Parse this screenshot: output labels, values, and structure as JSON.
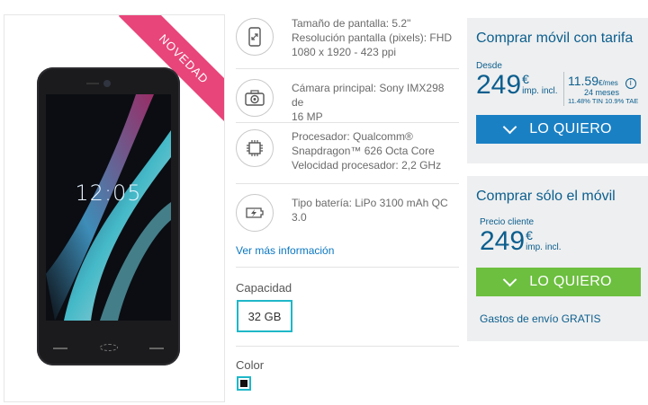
{
  "product": {
    "badge": "NOVEDAD",
    "screen_time": "12:05"
  },
  "specs": [
    {
      "icon": "screen-size-icon",
      "lines": [
        "Tamaño de pantalla: 5.2\"",
        "Resolución pantalla (pixels): FHD",
        "1080 x 1920 - 423 ppi"
      ]
    },
    {
      "icon": "camera-icon",
      "lines": [
        "Cámara principal: Sony IMX298 de",
        "16 MP"
      ]
    },
    {
      "icon": "processor-icon",
      "lines": [
        "Procesador: Qualcomm®",
        "Snapdragon™ 626 Octa Core",
        "Velocidad procesador: 2,2 GHz"
      ]
    },
    {
      "icon": "battery-icon",
      "lines": [
        "Tipo batería: LiPo 3100 mAh QC 3.0"
      ]
    }
  ],
  "more_info": "Ver más información",
  "capacity": {
    "label": "Capacidad",
    "selected": "32 GB"
  },
  "color": {
    "label": "Color",
    "selected_hex": "#111111"
  },
  "tariff_box": {
    "title": "Comprar móvil con tarifa",
    "from": "Desde",
    "price": "249",
    "currency": "€",
    "tax": "imp. incl.",
    "monthly_price": "11.59",
    "monthly_unit": "€/mes",
    "months": "24 meses",
    "rates": "11.48% TIN 10.9% TAE",
    "button": "LO QUIERO"
  },
  "free_box": {
    "title": "Comprar sólo el móvil",
    "price_label": "Precio cliente",
    "price": "249",
    "currency": "€",
    "tax": "imp. incl.",
    "button": "LO QUIERO"
  },
  "shipping": "Gastos de envío GRATIS",
  "colors": {
    "blue_button": "#1a80c4",
    "green_button": "#6cbf3f",
    "accent_cyan": "#1fb7c8",
    "badge_pink": "#e8457a",
    "brand_text": "#0b5e8e"
  }
}
